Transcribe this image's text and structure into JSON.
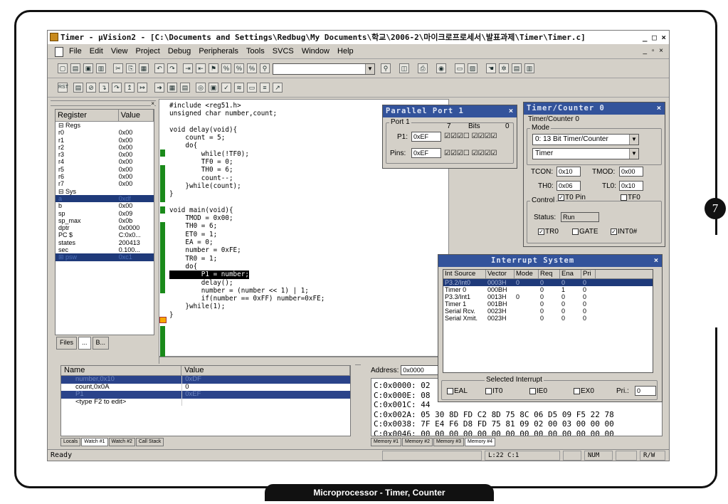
{
  "title": "Timer - µVision2 - [C:\\Documents and Settings\\Redbug\\My Documents\\학교\\2006-2\\마이크로프로세서\\발표과제\\Timer\\Timer.c]",
  "window_controls": "_ □ ×",
  "mdi_controls": "_ ▫ ×",
  "page_number": "7",
  "caption": "Microprocessor - Timer, Counter",
  "menu": [
    "File",
    "Edit",
    "View",
    "Project",
    "Debug",
    "Peripherals",
    "Tools",
    "SVCS",
    "Window",
    "Help"
  ],
  "register_panel": {
    "col_register": "Register",
    "col_value": "Value",
    "rows": [
      {
        "name": "⊟ Regs",
        "value": ""
      },
      {
        "name": "    r0",
        "value": "0x00"
      },
      {
        "name": "    r1",
        "value": "0x00"
      },
      {
        "name": "    r2",
        "value": "0x00"
      },
      {
        "name": "    r3",
        "value": "0x00"
      },
      {
        "name": "    r4",
        "value": "0x00"
      },
      {
        "name": "    r5",
        "value": "0x00"
      },
      {
        "name": "    r6",
        "value": "0x00"
      },
      {
        "name": "    r7",
        "value": "0x00"
      },
      {
        "name": "⊟ Sys",
        "value": ""
      },
      {
        "name": "    a",
        "value": "0xdf",
        "sel": true
      },
      {
        "name": "    b",
        "value": "0x00"
      },
      {
        "name": "    sp",
        "value": "0x09"
      },
      {
        "name": "     sp_max",
        "value": "0x0b"
      },
      {
        "name": "    dptr",
        "value": "0x0000"
      },
      {
        "name": "    PC  $",
        "value": "C:0x0..."
      },
      {
        "name": "    states",
        "value": "200413"
      },
      {
        "name": "    sec",
        "value": "0.100..."
      },
      {
        "name": "  ⊞  psw",
        "value": "0xc1",
        "sel": true
      }
    ],
    "tabs": [
      "Files",
      "...",
      "B..."
    ]
  },
  "code_lines": [
    "#include <reg51.h>",
    "unsigned char number,count;",
    "",
    "void delay(void){",
    "    count = 5;",
    "    do{",
    "        while(!TF0);",
    "        TF0 = 0;",
    "        TH0 = 6;",
    "        count--;",
    "    }while(count);",
    "}",
    "",
    "void main(void){",
    "    TMOD = 0x00;",
    "    TH0 = 6;",
    "    ET0 = 1;",
    "    EA = 0;",
    "    number = 0xFE;",
    "    TR0 = 1;",
    "    do{",
    "        P1 = number;",
    "        delay();",
    "        number = (number << 1) | 1;",
    "        if(number == 0xFF) number=0xFE;",
    "    }while(1);",
    "}"
  ],
  "parallel_port": {
    "title": "Parallel Port 1",
    "group": "Port 1",
    "bit_high": "7",
    "bits_label": "Bits",
    "bit_low": "0",
    "p1_label": "P1:",
    "p1_value": "0xEF",
    "pins_label": "Pins:",
    "pins_value": "0xEF"
  },
  "timer": {
    "title": "Timer/Counter 0",
    "group": "Timer/Counter 0",
    "mode_group": "Mode",
    "mode_value": "0: 13 Bit Timer/Counter",
    "type_value": "Timer",
    "tcon_label": "TCON:",
    "tcon_value": "0x10",
    "tmod_label": "TMOD:",
    "tmod_value": "0x00",
    "th0_label": "TH0:",
    "th0_value": "0x06",
    "tl0_label": "TL0:",
    "tl0_value": "0x10",
    "control_group": "Control",
    "t0pin_label": "T0 Pin",
    "tf0_label": "TF0",
    "status_label": "Status:",
    "status_value": "Run",
    "tr0_label": "TR0",
    "gate_label": "GATE",
    "int0_label": "INT0#"
  },
  "interrupt": {
    "title": "Interrupt System",
    "headers": [
      "Int Source",
      "Vector",
      "Mode",
      "Req",
      "Ena",
      "Pri"
    ],
    "rows": [
      {
        "src": "P3.2/Int0",
        "vec": "0003H",
        "mode": "0",
        "req": "0",
        "ena": "0",
        "pri": "0",
        "sel": true
      },
      {
        "src": "Timer 0",
        "vec": "000BH",
        "mode": "",
        "req": "0",
        "ena": "1",
        "pri": "0"
      },
      {
        "src": "P3.3/Int1",
        "vec": "0013H",
        "mode": "0",
        "req": "0",
        "ena": "0",
        "pri": "0"
      },
      {
        "src": "Timer 1",
        "vec": "001BH",
        "mode": "",
        "req": "0",
        "ena": "0",
        "pri": "0"
      },
      {
        "src": "Serial Rcv.",
        "vec": "0023H",
        "mode": "",
        "req": "0",
        "ena": "0",
        "pri": "0"
      },
      {
        "src": "Serial Xmit.",
        "vec": "0023H",
        "mode": "",
        "req": "0",
        "ena": "0",
        "pri": "0"
      }
    ],
    "selected_group": "Selected Interrupt",
    "eal": "EAL",
    "it0": "IT0",
    "ie0": "IE0",
    "ex0": "EX0",
    "pri_label": "Pri.:",
    "pri_value": "0"
  },
  "watch": {
    "col_name": "Name",
    "col_value": "Value",
    "rows": [
      {
        "name": "number,0x10",
        "value": "0xDF",
        "sel": true
      },
      {
        "name": "count,0x0A",
        "value": "0"
      },
      {
        "name": "P1",
        "value": "0xEF",
        "sel": true
      },
      {
        "name": "<type F2 to edit>",
        "value": ""
      }
    ],
    "tabs": [
      "Locals",
      "Watch #1",
      "Watch #2",
      "Call Stack"
    ]
  },
  "memory": {
    "address_label": "Address:",
    "address_value": "0x0000",
    "lines": [
      "C:0x0000: 02",
      "C:0x000E: 08",
      "C:0x001C: 44",
      "C:0x002A: 05 30 8D FD C2 8D 75 8C 06 D5 09 F5 22 78",
      "C:0x0038: 7F E4 F6 D8 FD 75 81 09 02 00 03 00 00 00",
      "C:0x0046: 00 00 00 00 00 00 00 00 00 00 00 00 00 00"
    ],
    "tabs": [
      "Memory #1",
      "Memory #2",
      "Memory #3",
      "Memory #4"
    ]
  },
  "status": {
    "ready": "Ready",
    "pos": "L:22 C:1",
    "num": "NUM",
    "rw": "R/W"
  }
}
